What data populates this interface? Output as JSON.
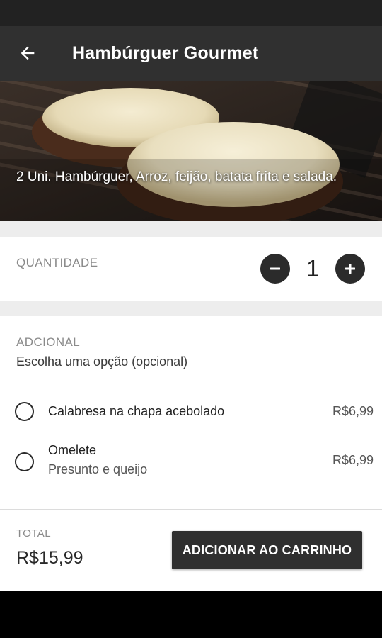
{
  "app_bar": {
    "title": "Hambúrguer Gourmet",
    "back_icon": "arrow-left-icon"
  },
  "hero": {
    "description": "2 Uni. Hambúrguer, Arroz, feijão, batata frita e salada."
  },
  "quantity": {
    "label": "QUANTIDADE",
    "value": "1",
    "decrement_icon": "minus-circle-icon",
    "increment_icon": "plus-circle-icon"
  },
  "addon": {
    "title": "ADCIONAL",
    "subtitle": "Escolha uma opção (opcional)",
    "options": [
      {
        "name": "Calabresa na chapa acebolado",
        "description": "",
        "price": "R$6,99",
        "selected": false
      },
      {
        "name": "Omelete",
        "description": "Presunto e queijo",
        "price": "R$6,99",
        "selected": false
      }
    ]
  },
  "footer": {
    "total_label": "TOTAL",
    "total_value": "R$15,99",
    "add_button": "ADICIONAR AO CARRINHO"
  },
  "colors": {
    "app_bar": "#303030",
    "status_bar": "#222222",
    "button": "#2f2f2f",
    "section_bg": "#ededed"
  }
}
